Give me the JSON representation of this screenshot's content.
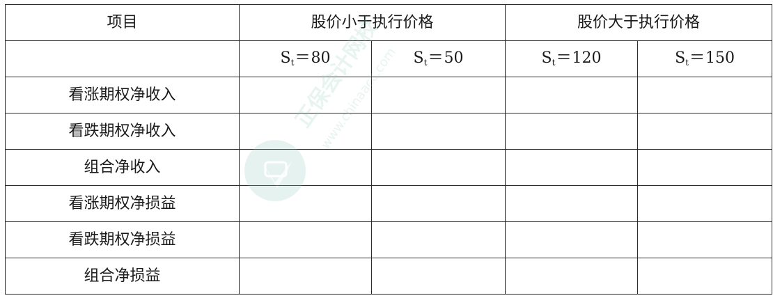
{
  "table": {
    "header1": {
      "item": "项目",
      "group_low": "股价小于执行价格",
      "group_high": "股价大于执行价格"
    },
    "header2": [
      {
        "var": "S",
        "sub": "t",
        "op": "＝",
        "value": "80"
      },
      {
        "var": "S",
        "sub": "t",
        "op": "＝",
        "value": "50"
      },
      {
        "var": "S",
        "sub": "t",
        "op": "＝",
        "value": "120"
      },
      {
        "var": "S",
        "sub": "t",
        "op": "＝",
        "value": "150"
      }
    ],
    "rows": [
      "看涨期权净收入",
      "看跌期权净收入",
      "组合净收入",
      "看涨期权净损益",
      "看跌期权净损益",
      "组合净损益"
    ]
  },
  "watermark": {
    "brand": "正保会计网校",
    "url": "www.chinaacc.com",
    "color": "#8fc9b8"
  }
}
